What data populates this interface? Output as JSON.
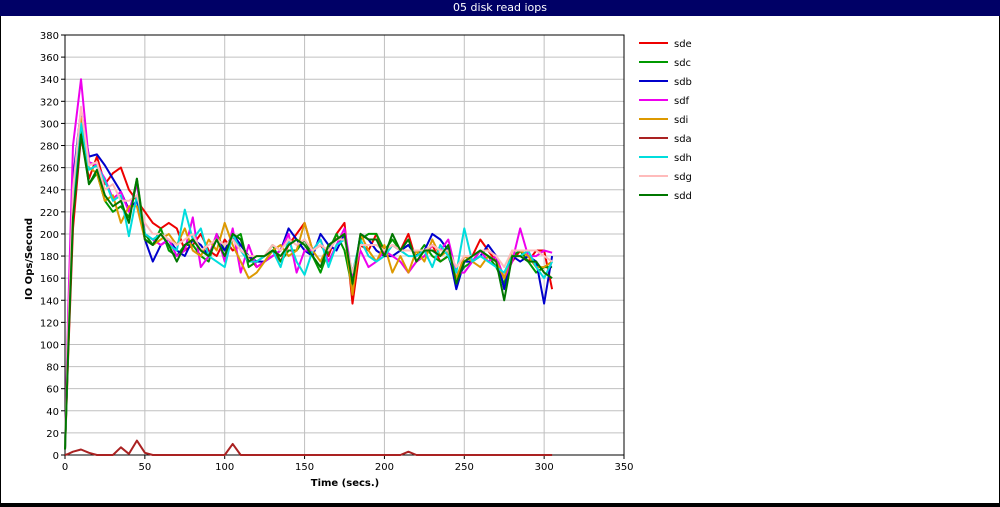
{
  "window": {
    "title": "05 disk read iops"
  },
  "chart_data": {
    "type": "line",
    "title": "",
    "xlabel": "Time (secs.)",
    "ylabel": "IO Ops/Second",
    "xlim": [
      0,
      350
    ],
    "ylim": [
      0,
      380
    ],
    "xticks": [
      0,
      50,
      100,
      150,
      200,
      250,
      300,
      350
    ],
    "yticks": [
      0,
      20,
      40,
      60,
      80,
      100,
      120,
      140,
      160,
      180,
      200,
      220,
      240,
      260,
      280,
      300,
      320,
      340,
      360,
      380
    ],
    "grid": true,
    "legend_position": "right",
    "x": [
      0,
      2,
      5,
      10,
      15,
      20,
      25,
      30,
      35,
      40,
      45,
      50,
      55,
      60,
      65,
      70,
      75,
      80,
      85,
      90,
      95,
      100,
      105,
      110,
      115,
      120,
      125,
      130,
      135,
      140,
      145,
      150,
      155,
      160,
      165,
      170,
      175,
      180,
      185,
      190,
      195,
      200,
      205,
      210,
      215,
      220,
      225,
      230,
      235,
      240,
      245,
      250,
      255,
      260,
      265,
      270,
      275,
      280,
      285,
      290,
      295,
      300,
      305
    ],
    "series": [
      {
        "name": "sde",
        "color": "#ee0000",
        "values": [
          5,
          90,
          205,
          288,
          250,
          270,
          245,
          255,
          260,
          240,
          230,
          220,
          210,
          205,
          210,
          205,
          185,
          190,
          200,
          185,
          180,
          195,
          185,
          190,
          180,
          170,
          175,
          185,
          175,
          190,
          200,
          210,
          185,
          190,
          180,
          200,
          210,
          137,
          190,
          185,
          200,
          180,
          190,
          185,
          200,
          175,
          180,
          190,
          175,
          180,
          160,
          175,
          180,
          195,
          185,
          175,
          160,
          175,
          185,
          175,
          185,
          185,
          150
        ]
      },
      {
        "name": "sdc",
        "color": "#009900",
        "values": [
          5,
          100,
          220,
          295,
          245,
          255,
          230,
          220,
          225,
          215,
          250,
          200,
          190,
          205,
          185,
          180,
          190,
          190,
          180,
          175,
          200,
          185,
          195,
          200,
          170,
          175,
          180,
          190,
          175,
          185,
          185,
          195,
          180,
          165,
          185,
          200,
          185,
          150,
          195,
          200,
          200,
          185,
          195,
          185,
          190,
          180,
          190,
          180,
          175,
          180,
          160,
          170,
          175,
          185,
          180,
          170,
          155,
          180,
          185,
          175,
          165,
          170,
          170
        ]
      },
      {
        "name": "sdb",
        "color": "#0000cc",
        "values": [
          5,
          110,
          250,
          312,
          270,
          272,
          262,
          250,
          238,
          222,
          230,
          195,
          175,
          190,
          195,
          185,
          180,
          195,
          190,
          180,
          195,
          185,
          200,
          190,
          180,
          175,
          175,
          180,
          185,
          205,
          195,
          185,
          180,
          200,
          190,
          185,
          200,
          155,
          200,
          195,
          185,
          180,
          180,
          185,
          190,
          180,
          185,
          200,
          195,
          185,
          150,
          175,
          175,
          180,
          190,
          180,
          150,
          180,
          175,
          180,
          175,
          137,
          180
        ]
      },
      {
        "name": "sdf",
        "color": "#ee00ee",
        "values": [
          5,
          130,
          280,
          340,
          265,
          262,
          250,
          232,
          238,
          220,
          245,
          200,
          195,
          190,
          195,
          180,
          185,
          215,
          170,
          180,
          200,
          175,
          205,
          165,
          190,
          170,
          175,
          180,
          185,
          200,
          165,
          185,
          185,
          195,
          175,
          190,
          205,
          160,
          185,
          170,
          175,
          185,
          180,
          175,
          165,
          175,
          180,
          190,
          185,
          195,
          165,
          165,
          175,
          185,
          175,
          180,
          160,
          175,
          205,
          180,
          180,
          185,
          183
        ]
      },
      {
        "name": "sdi",
        "color": "#dd9900",
        "values": [
          5,
          105,
          230,
          305,
          260,
          255,
          230,
          235,
          210,
          225,
          225,
          195,
          190,
          195,
          200,
          190,
          205,
          185,
          180,
          195,
          185,
          210,
          190,
          175,
          160,
          165,
          175,
          185,
          190,
          180,
          185,
          210,
          185,
          175,
          190,
          195,
          200,
          145,
          200,
          185,
          175,
          190,
          165,
          180,
          165,
          185,
          175,
          195,
          180,
          185,
          160,
          180,
          175,
          170,
          180,
          175,
          160,
          185,
          185,
          180,
          170,
          170,
          175
        ]
      },
      {
        "name": "sda",
        "color": "#aa2222",
        "values": [
          0,
          1,
          3,
          5,
          2,
          0,
          0,
          0,
          7,
          1,
          13,
          2,
          0,
          0,
          0,
          0,
          0,
          0,
          0,
          0,
          0,
          0,
          10,
          0,
          0,
          0,
          0,
          0,
          0,
          0,
          0,
          0,
          0,
          0,
          0,
          0,
          0,
          0,
          0,
          0,
          0,
          0,
          0,
          0,
          3,
          0,
          0,
          0,
          0,
          0,
          0,
          0,
          0,
          0,
          0,
          0,
          0,
          0,
          0,
          0,
          0,
          0,
          0
        ]
      },
      {
        "name": "sdh",
        "color": "#00dddd",
        "values": [
          5,
          100,
          230,
          300,
          258,
          262,
          248,
          230,
          235,
          198,
          235,
          200,
          195,
          200,
          190,
          185,
          222,
          195,
          205,
          180,
          175,
          170,
          200,
          185,
          175,
          175,
          180,
          185,
          170,
          195,
          175,
          163,
          185,
          195,
          170,
          190,
          195,
          165,
          195,
          180,
          175,
          180,
          190,
          185,
          180,
          180,
          185,
          170,
          190,
          180,
          165,
          205,
          175,
          180,
          175,
          170,
          165,
          180,
          180,
          185,
          170,
          160,
          175
        ]
      },
      {
        "name": "sdg",
        "color": "#ffbbbb",
        "values": [
          5,
          110,
          240,
          315,
          262,
          265,
          240,
          245,
          230,
          230,
          235,
          210,
          200,
          200,
          195,
          190,
          195,
          200,
          185,
          190,
          195,
          190,
          195,
          185,
          180,
          180,
          180,
          190,
          185,
          195,
          190,
          195,
          185,
          190,
          185,
          195,
          195,
          165,
          190,
          190,
          190,
          185,
          190,
          185,
          185,
          185,
          185,
          190,
          185,
          185,
          170,
          180,
          180,
          185,
          185,
          180,
          170,
          185,
          185,
          185,
          185,
          180,
          175
        ]
      },
      {
        "name": "sdd",
        "color": "#007700",
        "values": [
          5,
          95,
          215,
          290,
          245,
          258,
          235,
          225,
          230,
          210,
          250,
          195,
          190,
          200,
          190,
          175,
          190,
          195,
          185,
          180,
          195,
          180,
          200,
          195,
          175,
          180,
          180,
          185,
          180,
          190,
          195,
          190,
          180,
          170,
          190,
          195,
          200,
          155,
          200,
          195,
          195,
          180,
          200,
          185,
          195,
          175,
          185,
          185,
          180,
          190,
          155,
          175,
          180,
          185,
          180,
          175,
          140,
          180,
          180,
          175,
          175,
          165,
          160
        ]
      }
    ]
  }
}
